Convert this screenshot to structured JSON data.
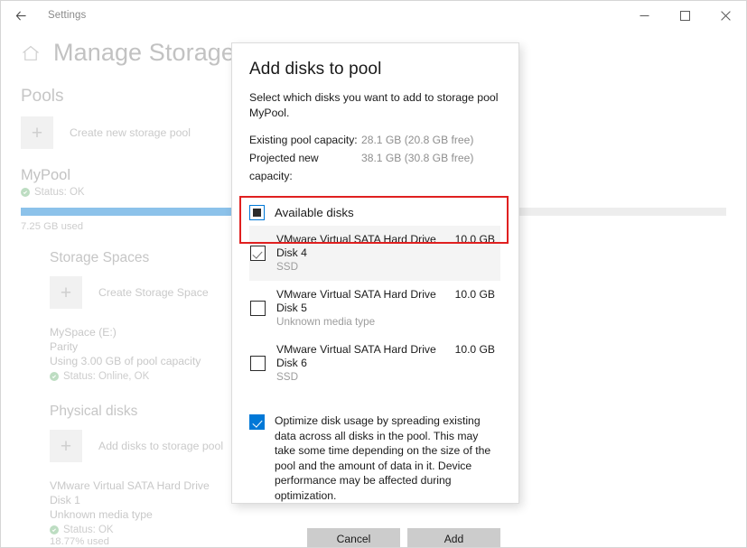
{
  "window": {
    "back_icon": "back-arrow-icon",
    "app_label": "Settings",
    "minimize_label": "—",
    "maximize_label": "□",
    "close_label": "✕"
  },
  "page": {
    "home_icon": "home-icon",
    "title": "Manage Storage Spaces",
    "pools_heading": "Pools",
    "create_pool_label": "Create new storage pool",
    "pool": {
      "name": "MyPool",
      "status": "Status: OK",
      "used_label": "7.25 GB used",
      "used_percent": 26
    },
    "storage_spaces_heading": "Storage Spaces",
    "create_space_label": "Create Storage Space",
    "space": {
      "name": "MySpace (E:)",
      "resiliency": "Parity",
      "capacity": "Using 3.00 GB of pool capacity",
      "status": "Status: Online, OK"
    },
    "physical_disks_heading": "Physical disks",
    "add_disks_label": "Add disks to storage pool",
    "physical_disk": {
      "model": "VMware Virtual SATA Hard Drive",
      "number": "Disk 1",
      "media": "Unknown media type",
      "status": "Status: OK",
      "used": "18.77% used"
    }
  },
  "dialog": {
    "title": "Add disks to pool",
    "description": "Select which disks you want to add to storage pool MyPool.",
    "capacities": [
      {
        "label": "Existing pool capacity:",
        "value": "28.1 GB (20.8 GB free)"
      },
      {
        "label": "Projected new capacity:",
        "value": "38.1 GB (30.8 GB free)"
      }
    ],
    "available_disks_label": "Available disks",
    "available_disks_state": "indeterminate",
    "disks": [
      {
        "model": "VMware Virtual SATA Hard Drive",
        "number": "Disk 4",
        "media": "SSD",
        "size": "10.0 GB",
        "checked": true,
        "highlighted": true
      },
      {
        "model": "VMware Virtual SATA Hard Drive",
        "number": "Disk 5",
        "media": "Unknown media type",
        "size": "10.0 GB",
        "checked": false,
        "highlighted": false
      },
      {
        "model": "VMware Virtual SATA Hard Drive",
        "number": "Disk 6",
        "media": "SSD",
        "size": "10.0 GB",
        "checked": false,
        "highlighted": false
      }
    ],
    "optimize": {
      "checked": true,
      "text": "Optimize disk usage by spreading existing data across all disks in the pool. This may take some time depending on the size of the pool and the amount of data in it. Device performance may be affected during optimization."
    },
    "cancel_label": "Cancel",
    "add_label": "Add"
  },
  "colors": {
    "accent": "#0078d7",
    "progress_fill": "#8cc2ea",
    "highlight_outline": "#e02020",
    "status_green": "#bdddc2",
    "button_bg": "#cccccc"
  }
}
